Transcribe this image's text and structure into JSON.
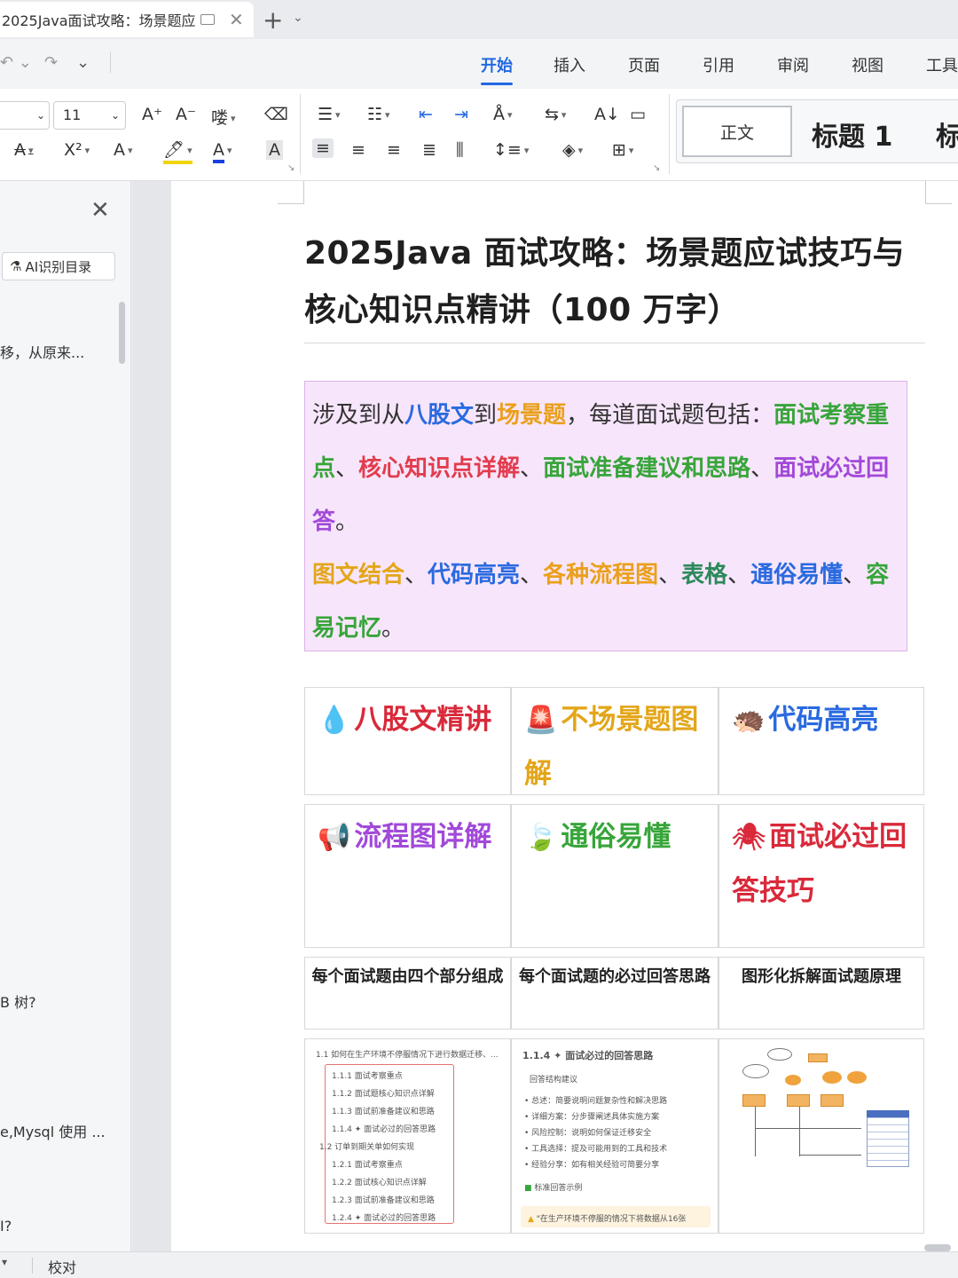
{
  "tab": {
    "title": "2025Java面试攻略：场景题应"
  },
  "menu": [
    "开始",
    "插入",
    "页面",
    "引用",
    "审阅",
    "视图",
    "工具"
  ],
  "ribbon": {
    "font_size": "11",
    "btn_grow": "A⁺",
    "btn_shrink": "A⁻",
    "btn_phonetic": "喽",
    "btn_clear": "⌫",
    "btn_strike": "A",
    "btn_super": "X²",
    "btn_effect": "A",
    "btn_highlight": "🖊",
    "btn_color": "A",
    "btn_charbox": "A",
    "style_normal": "正文",
    "style_h1": "标题 1",
    "style_h2": "标"
  },
  "nav": {
    "ai_toc": "AI识别目录",
    "items": [
      "移，从原来...",
      "B 树?",
      "e,Mysql 使用 ...",
      "I?"
    ]
  },
  "doc": {
    "title": "2025Java 面试攻略：场景题应试技巧与核心知识点精讲（100 万字）",
    "intro": {
      "p1_a": "涉及到从",
      "p1_b": "八股文",
      "p1_c": "到",
      "p1_d": "场景题",
      "p1_e": "，每道面试题包括：",
      "p1_f": "面试考察重点",
      "p1_g": "、",
      "p1_h": "核心知识点详解",
      "p1_i": "、",
      "p1_j": "面试准备建议和思路",
      "p1_k": "、",
      "p1_l": "面试必过回答",
      "p1_m": "。",
      "p2_a": "图文结合",
      "p2_b": "、",
      "p2_c": "代码高亮",
      "p2_d": "、",
      "p2_e": "各种流程图",
      "p2_f": "、",
      "p2_g": "表格",
      "p2_h": "、",
      "p2_i": "通俗易懂",
      "p2_j": "、",
      "p2_k": "容易记忆",
      "p2_l": "。"
    },
    "features": [
      {
        "icon": "💧",
        "label": "八股文精讲",
        "color": "#d9293a"
      },
      {
        "icon": "🚨",
        "label": "不场景题图解",
        "color": "#e3a61a"
      },
      {
        "icon": "🦔",
        "label": "代码高亮",
        "color": "#2a6ae0"
      },
      {
        "icon": "📢",
        "label": "流程图详解",
        "color": "#a249d9"
      },
      {
        "icon": "🍃",
        "label": "通俗易懂",
        "color": "#37a53a"
      },
      {
        "icon": "🕷",
        "label": "面试必过回答技巧",
        "color": "#d9293a"
      }
    ],
    "captions": [
      "每个面试题由四个部分组成",
      "每个面试题的必过回答思路",
      "图形化拆解面试题原理"
    ],
    "thumb1": {
      "header": "1.1 如何在生产环境不停服情况下进行数据迁移、...",
      "items": [
        "1.1.1 面试考察重点",
        "1.1.2 面试题核心知识点详解",
        "1.1.3 面试前准备建议和思路",
        "1.1.4 ✦ 面试必过的回答思路",
        "1.2 订单到期关单如何实现",
        "1.2.1 面试考察重点",
        "1.2.2 面试核心知识点详解",
        "1.2.3 面试前准备建议和思路",
        "1.2.4 ✦ 面试必过的回答思路"
      ]
    },
    "thumb2": {
      "header": "1.1.4 ✦ 面试必过的回答思路",
      "sub": "回答结构建议",
      "bullets": [
        "总述：简要说明问题复杂性和解决思路",
        "详细方案：分步骤阐述具体实施方案",
        "风险控制：说明如何保证迁移安全",
        "工具选择：提及可能用到的工具和技术",
        "经验分享：如有相关经验可简要分享"
      ],
      "example": "标准回答示例",
      "quote": "\"在生产环境不停服的情况下将数据从16张"
    }
  },
  "status": {
    "proof": "校对"
  }
}
